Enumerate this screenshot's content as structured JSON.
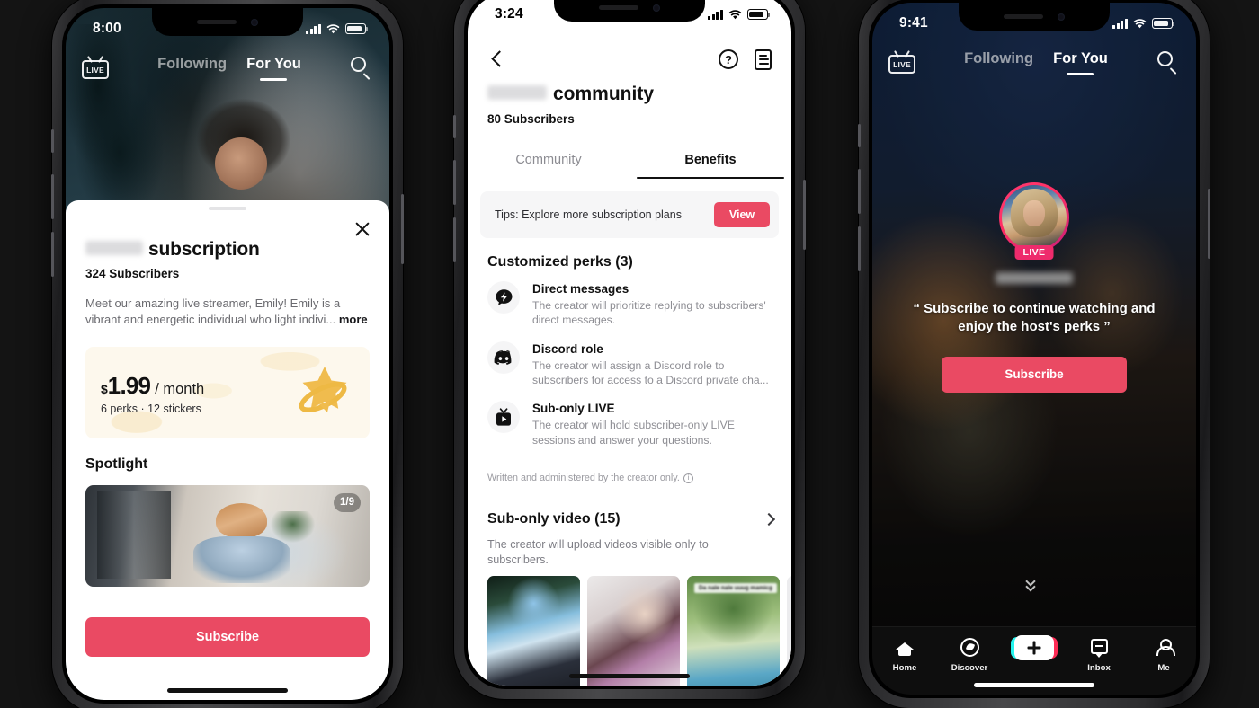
{
  "meta": {
    "accent_pink": "#ea4a63",
    "live_pink": "#ee2b6c",
    "sticker_yellow": "#f0bc4e",
    "page_background": "#141414"
  },
  "phone_left": {
    "status_bar": {
      "time": "8:00",
      "signal_icon": "cellular-bars-icon",
      "wifi_icon": "wifi-icon",
      "battery_icon": "battery-icon"
    },
    "feed_header": {
      "live_label": "LIVE",
      "tabs": [
        {
          "label": "Following",
          "active": false
        },
        {
          "label": "For You",
          "active": true
        }
      ],
      "search_icon": "search-icon"
    },
    "sheet": {
      "close_icon": "close-icon",
      "grab_handle": "drag-handle",
      "redacted_name": "",
      "title": "subscription",
      "subscribers": "324 Subscribers",
      "description": "Meet our amazing live streamer, Emily! Emily is a vibrant and energetic individual who light indivi...",
      "more_label": "more",
      "price": {
        "currency": "$",
        "amount": "1.99",
        "period": "/ month",
        "meta": "6 perks · 12 stickers",
        "sticker_icon": "star-planet-sticker"
      },
      "spotlight_heading": "Spotlight",
      "spotlight_counter": "1/9",
      "subscribe_label": "Subscribe"
    }
  },
  "phone_middle": {
    "status_bar": {
      "time": "3:24",
      "signal_icon": "cellular-bars-icon",
      "wifi_icon": "wifi-icon",
      "battery_icon": "battery-icon"
    },
    "nav": {
      "back_icon": "back-chevron-icon",
      "help_icon": "help-circle-icon",
      "help_glyph": "?",
      "doc_icon": "document-icon"
    },
    "redacted_name": "",
    "title": "community",
    "subscribers": "80 Subscribers",
    "tabs": [
      {
        "label": "Community",
        "active": false
      },
      {
        "label": "Benefits",
        "active": true
      }
    ],
    "tips": {
      "text": "Tips: Explore more subscription plans",
      "button_label": "View"
    },
    "perks_heading": "Customized perks (3)",
    "perks": [
      {
        "icon": "lightning-bolt-message-icon",
        "title": "Direct messages",
        "desc": "The creator will prioritize replying to subscribers' direct messages."
      },
      {
        "icon": "discord-logo-icon",
        "title": "Discord role",
        "desc": "The creator will assign a Discord role to subscribers for access to a Discord private cha..."
      },
      {
        "icon": "live-tv-icon",
        "title": "Sub-only LIVE",
        "desc": "The creator will hold subscriber-only LIVE sessions and answer your questions."
      }
    ],
    "perks_note": "Written and administered by the creator only.",
    "perks_note_icon": "info-circle-icon",
    "sub_only_video": {
      "heading": "Sub-only video (15)",
      "chevron_icon": "chevron-right-icon",
      "desc": "The creator will upload videos visible only to subscribers.",
      "thumb_caption": "Da nale nale uuug mamicg"
    }
  },
  "phone_right": {
    "status_bar": {
      "time": "9:41",
      "signal_icon": "cellular-bars-icon",
      "wifi_icon": "wifi-icon",
      "battery_icon": "battery-icon"
    },
    "feed_header": {
      "live_label": "LIVE",
      "tabs": [
        {
          "label": "Following",
          "active": false
        },
        {
          "label": "For You",
          "active": true
        }
      ],
      "search_icon": "search-icon"
    },
    "live_badge": "LIVE",
    "redacted_host_name": "",
    "quote": "“ Subscribe to continue watching and enjoy the host's perks ”",
    "subscribe_label": "Subscribe",
    "scroll_hint_icon": "double-chevron-down-icon",
    "tabbar": [
      {
        "icon": "home-icon",
        "label": "Home"
      },
      {
        "icon": "compass-discover-icon",
        "label": "Discover"
      },
      {
        "icon": "plus-create-icon",
        "label": ""
      },
      {
        "icon": "inbox-message-icon",
        "label": "Inbox"
      },
      {
        "icon": "person-me-icon",
        "label": "Me"
      }
    ]
  }
}
